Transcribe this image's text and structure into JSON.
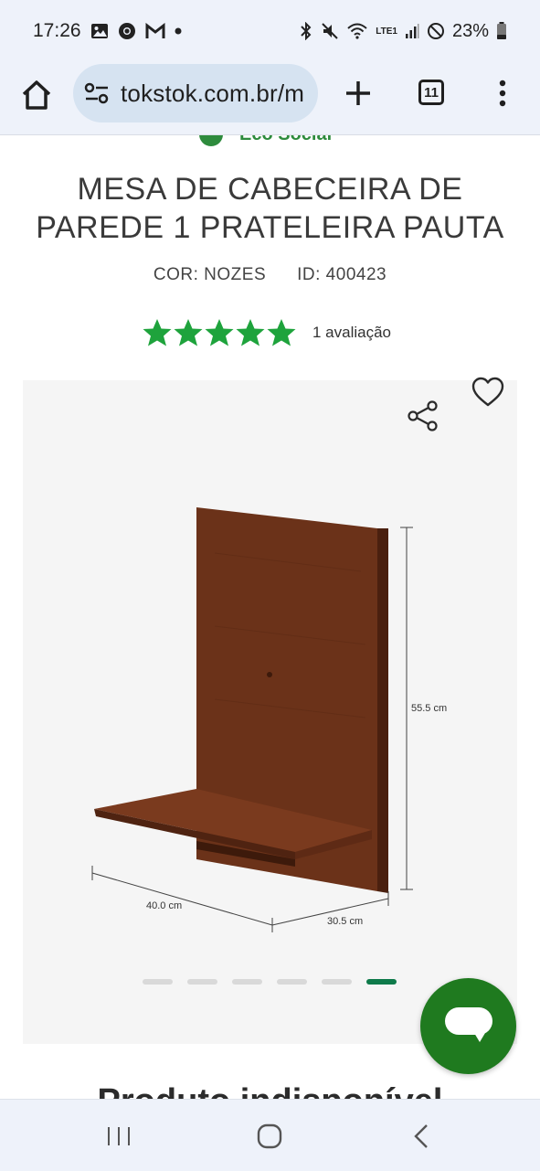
{
  "status_bar": {
    "time": "17:26",
    "battery": "23%",
    "network": "LTE1",
    "icons": [
      "gallery-icon",
      "chrome-icon",
      "gmail-icon",
      "dot-icon",
      "bluetooth-icon",
      "mute-icon",
      "wifi-icon",
      "signal-icon",
      "dnd-icon",
      "battery-icon"
    ]
  },
  "browser": {
    "url": "tokstok.com.br/m",
    "tab_count": "11"
  },
  "product": {
    "eco_label": "Eco Social",
    "title_line1": "MESA DE CABECEIRA DE",
    "title_line2": "PAREDE 1 PRATELEIRA PAUTA",
    "color": "COR: NOZES",
    "id": "ID: 400423",
    "rating_value": 5,
    "rating_max": 5,
    "review_count": "1 avaliação",
    "dimensions": {
      "height": "55.5 cm",
      "width": "40.0 cm",
      "depth": "30.5 cm"
    },
    "gallery_count": 6,
    "gallery_active": 6,
    "status_text": "Produto indisponível"
  },
  "colors": {
    "star": "#1ea33c",
    "chat": "#1f7a1f",
    "active_dot": "#0e7a4a",
    "wood": "#6b3219"
  }
}
